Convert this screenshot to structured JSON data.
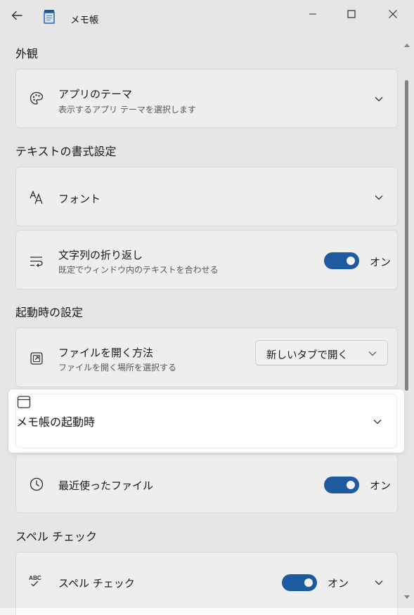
{
  "window": {
    "title": "メモ帳",
    "icons": {
      "back": "back-arrow-icon",
      "app": "notepad-icon",
      "maximize": "maximize-icon",
      "close": "close-icon"
    }
  },
  "sections": {
    "appearance": "外観",
    "text_format": "テキストの書式設定",
    "startup": "起動時の設定",
    "spellcheck": "スペル チェック"
  },
  "settings": {
    "theme": {
      "title": "アプリのテーマ",
      "desc": "表示するアプリ テーマを選択します",
      "icon": "palette-icon"
    },
    "font": {
      "title": "フォント",
      "icon": "font-icon"
    },
    "wrap": {
      "title": "文字列の折り返し",
      "desc": "既定でウィンドウ内のテキストを合わせる",
      "toggle_label": "オン",
      "on": true,
      "icon": "word-wrap-icon"
    },
    "open_method": {
      "title": "ファイルを開く方法",
      "desc": "ファイルを開く場所を選択する",
      "value": "新しいタブで開く",
      "icon": "open-external-icon"
    },
    "startup": {
      "title": "メモ帳の起動時",
      "icon": "window-icon"
    },
    "recent": {
      "title": "最近使ったファイル",
      "toggle_label": "オン",
      "on": true,
      "icon": "clock-icon"
    },
    "spell": {
      "title": "スペル チェック",
      "toggle_label": "オン",
      "on": true,
      "icon": "spellcheck-icon"
    }
  },
  "colors": {
    "accent": "#1f5fa8",
    "background": "#f3f3f3",
    "card": "#fbfbfb"
  }
}
